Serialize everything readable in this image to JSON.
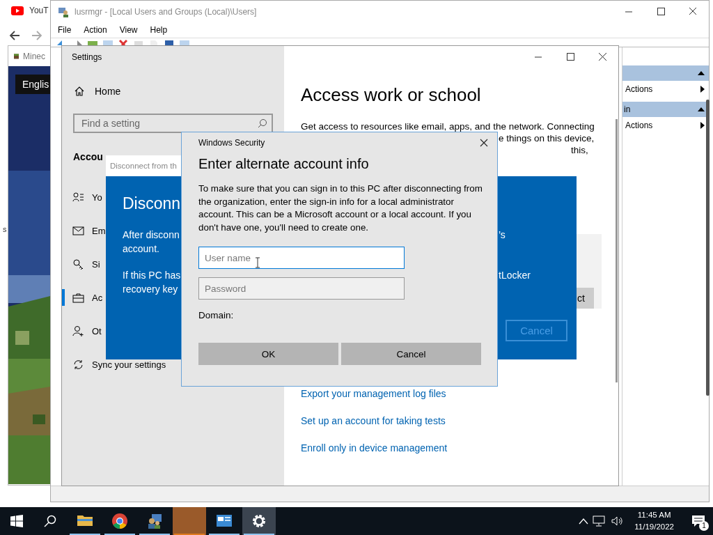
{
  "browser": {
    "tab": "YouT",
    "inner_tab": "Minec",
    "language_button": "Englis",
    "edge_text": "s"
  },
  "lusrmgr": {
    "title": "lusrmgr - [Local Users and Groups (Local)\\Users]",
    "menus": [
      "File",
      "Action",
      "View",
      "Help"
    ],
    "action_groups": [
      {
        "item": "Actions"
      },
      {
        "header": "in",
        "item": "Actions"
      }
    ]
  },
  "settings": {
    "title": "Settings",
    "home": "Home",
    "search": {
      "placeholder": "Find a setting"
    },
    "section": "Accou",
    "nav": [
      {
        "kind": "person-list",
        "label": "Yo",
        "selected": false
      },
      {
        "kind": "mail",
        "label": "Em",
        "selected": false
      },
      {
        "kind": "key",
        "label": "Si",
        "selected": false
      },
      {
        "kind": "briefcase",
        "label": "Ac",
        "selected": true
      },
      {
        "kind": "person-add",
        "label": "Ot",
        "selected": false
      },
      {
        "kind": "sync",
        "label": "Sync your settings",
        "selected": false
      }
    ],
    "page_title": "Access work or school",
    "description_lines": [
      "Get access to resources like email, apps, and the network. Connecting",
      "e things on this device,",
      "this,"
    ],
    "card_button": "ct",
    "links": [
      "Export your management log files",
      "Set up an account for taking tests",
      "Enroll only in device management"
    ]
  },
  "disconnect_dialog": {
    "title": "Disconnect from th",
    "heading": "Disconn",
    "paragraphs": [
      {
        "lines": [
          "After disconn",
          "account."
        ],
        "tail": "’s"
      },
      {
        "lines": [
          "If this PC has",
          "recovery key"
        ],
        "tail": "tLocker"
      }
    ],
    "cancel": {
      "label": "Cancel",
      "disabled": true
    }
  },
  "security_dialog": {
    "caption": "Windows Security",
    "title": "Enter alternate account info",
    "message": "To make sure that you can sign in to this PC after disconnecting from the organization, enter the sign-in info for a local administrator account. This can be a Microsoft account or a local account. If you don't have one, you'll need to create one.",
    "fields": [
      {
        "placeholder": "User name",
        "focused": true
      },
      {
        "placeholder": "Password",
        "focused": false
      }
    ],
    "domain_label": "Domain:",
    "buttons": [
      "OK",
      "Cancel"
    ]
  },
  "taskbar": {
    "apps": [
      {
        "kind": "explorer",
        "running": true,
        "active": false
      },
      {
        "kind": "chrome",
        "running": true,
        "active": false
      },
      {
        "kind": "users",
        "running": true,
        "active": false
      },
      {
        "kind": "orange",
        "running": true,
        "active": false
      },
      {
        "kind": "control-panel",
        "running": true,
        "active": false
      },
      {
        "kind": "settings",
        "running": true,
        "active": true
      }
    ],
    "time": "11:45 AM",
    "date": "11/19/2022",
    "notifications": "1"
  }
}
